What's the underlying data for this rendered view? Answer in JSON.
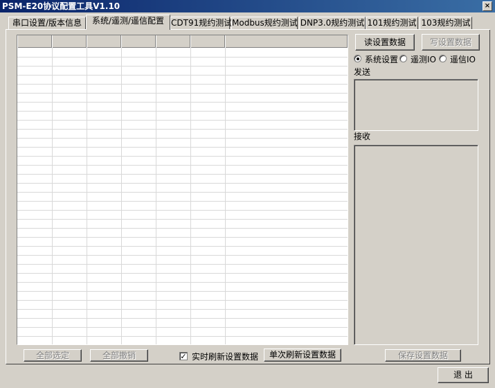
{
  "window": {
    "title": "PSM-E20协议配置工具V1.10",
    "close_glyph": "×"
  },
  "tabs": [
    {
      "label": "串口设置/版本信息",
      "active": false
    },
    {
      "label": "系统/遥测/遥信配置",
      "active": true
    },
    {
      "label": "CDT91规约测试",
      "active": false
    },
    {
      "label": "Modbus规约测试",
      "active": false
    },
    {
      "label": "DNP3.0规约测试",
      "active": false
    },
    {
      "label": "101规约测试",
      "active": false
    },
    {
      "label": "103规约测试",
      "active": false
    }
  ],
  "right_panel": {
    "read_button": "读设置数据",
    "write_button": "写设置数据",
    "radios": [
      {
        "label": "系统设置",
        "selected": true
      },
      {
        "label": "遥测IO",
        "selected": false
      },
      {
        "label": "遥信IO",
        "selected": false
      }
    ],
    "send_label": "发送",
    "receive_label": "接收",
    "save_button": "保存设置数据"
  },
  "bottom": {
    "select_all": "全部选定",
    "undo_all": "全部撤销",
    "realtime_refresh": "实时刷新设置数据",
    "realtime_checked": true,
    "check_glyph": "✓",
    "single_refresh": "单次刷新设置数据",
    "exit": "退 出"
  },
  "grid": {
    "column_count": 7,
    "row_count": 33
  }
}
